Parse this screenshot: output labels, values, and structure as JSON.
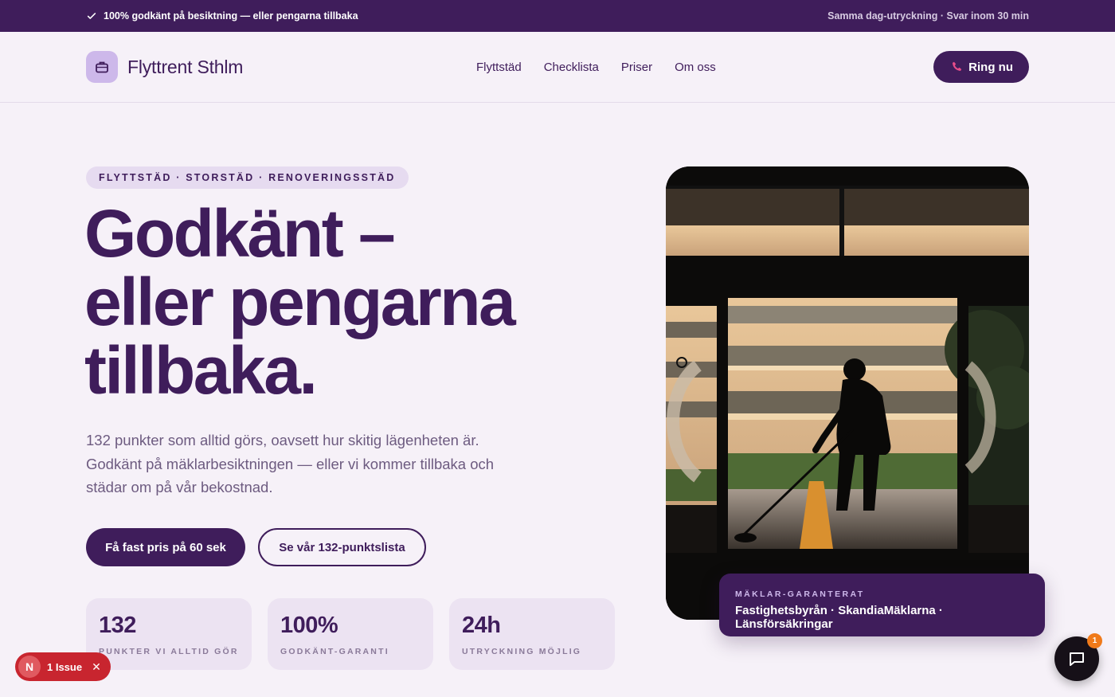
{
  "topbar": {
    "guarantee": "100% godkänt på besiktning — eller pengarna tillbaka",
    "response": "Samma dag-utryckning · Svar inom 30 min"
  },
  "brand": {
    "name": "Flyttrent Sthlm",
    "logo_icon": "briefcase-icon"
  },
  "nav": {
    "items": [
      "Flyttstäd",
      "Checklista",
      "Priser",
      "Om oss"
    ],
    "call_label": "Ring nu",
    "call_icon": "phone-icon"
  },
  "hero": {
    "badge": "FLYTTSTÄD · STORSTÄD · RENOVERINGSSTÄD",
    "title_lines": [
      "Godkänt –",
      "eller pengarna",
      "tillbaka."
    ],
    "subtitle": "132 punkter som alltid görs, oavsett hur skitig lägenheten är. Godkänt på mäklarbesiktningen — eller vi kommer tillbaka och städar om på vår bekostnad.",
    "cta_primary": "Få fast pris på 60 sek",
    "cta_secondary": "Se vår 132-punktslista"
  },
  "stats": [
    {
      "value": "132",
      "label": "PUNKTER VI ALLTID GÖR"
    },
    {
      "value": "100%",
      "label": "GODKÄNT-GARANTI"
    },
    {
      "value": "24h",
      "label": "UTRYCKNING MÖJLIG"
    }
  ],
  "guarantee_card": {
    "label": "MÄKLAR-GARANTERAT",
    "text": "Fastighetsbyrån · SkandiaMäklarna · Länsförsäkringar"
  },
  "chat": {
    "icon": "chat-bubble-icon",
    "count": "1"
  },
  "issues": {
    "badge_letter": "N",
    "label": "1 Issue"
  },
  "colors": {
    "brand": "#3f1d5b",
    "background": "#f6f1f8",
    "accent_light": "#cdb8ea",
    "issue_red": "#c8252f"
  }
}
